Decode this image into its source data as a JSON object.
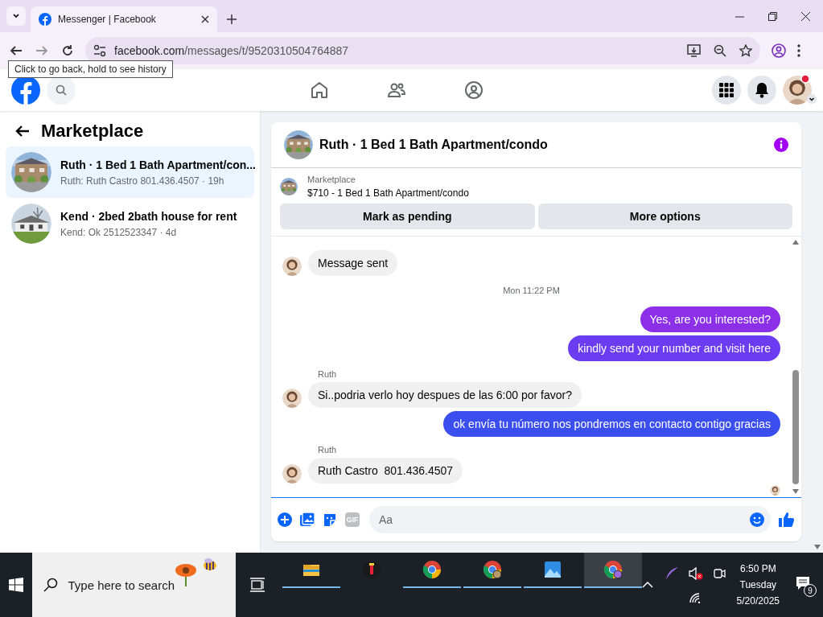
{
  "browser": {
    "tab_title": "Messenger | Facebook",
    "address_domain": "facebook.com",
    "address_path": "/messages/t/9520310504764887",
    "tooltip": "Click to go back, hold to see history"
  },
  "sidebar": {
    "title": "Marketplace",
    "conversations": [
      {
        "title": "Ruth · 1 Bed 1 Bath Apartment/con...",
        "preview": "Ruth: Ruth Castro 801.436.4507 · 19h",
        "selected": true
      },
      {
        "title": "Kend · 2bed 2bath house for rent",
        "preview": "Kend: Ok 2512523347 · 4d",
        "selected": false
      }
    ]
  },
  "chat": {
    "title": "Ruth · 1 Bed 1 Bath Apartment/condo",
    "listing": {
      "source": "Marketplace",
      "summary": "$710 - 1 Bed 1 Bath Apartment/condo"
    },
    "actions": [
      "Mark as pending",
      "More options"
    ],
    "messages": [
      {
        "kind": "received",
        "text": "Message sent"
      },
      {
        "kind": "timestamp",
        "text": "Mon 11:22 PM"
      },
      {
        "kind": "sent",
        "text": "Yes, are you interested?",
        "color": "#8b2fe8"
      },
      {
        "kind": "sent",
        "text": "kindly send your number and visit here",
        "color": "#6c3cf2"
      },
      {
        "kind": "sender",
        "text": "Ruth"
      },
      {
        "kind": "received",
        "text": "Si..podria verlo hoy despues de las 6:00 por favor?"
      },
      {
        "kind": "sent",
        "text": "ok envía tu número nos pondremos en contacto contigo gracias",
        "color": "#3b4ff0"
      },
      {
        "kind": "sender",
        "text": "Ruth"
      },
      {
        "kind": "received",
        "text": "Ruth Castro  801.436.4507"
      },
      {
        "kind": "seen"
      }
    ],
    "composer": {
      "gif_label": "GIF",
      "placeholder": "Aa"
    }
  },
  "taskbar": {
    "search_placeholder": "Type here to search",
    "apps": [
      {
        "kind": "folder",
        "running": true,
        "selected": false
      },
      {
        "kind": "dark",
        "running": false,
        "selected": false
      },
      {
        "kind": "chrome",
        "running": true,
        "selected": false
      },
      {
        "kind": "chrome-profile",
        "running": true,
        "selected": false
      },
      {
        "kind": "photos",
        "running": true,
        "selected": false
      },
      {
        "kind": "chrome-profile2",
        "running": true,
        "selected": true
      }
    ],
    "time": "6:50 PM",
    "day": "Tuesday",
    "date": "5/20/2025",
    "notification_count": "9"
  }
}
